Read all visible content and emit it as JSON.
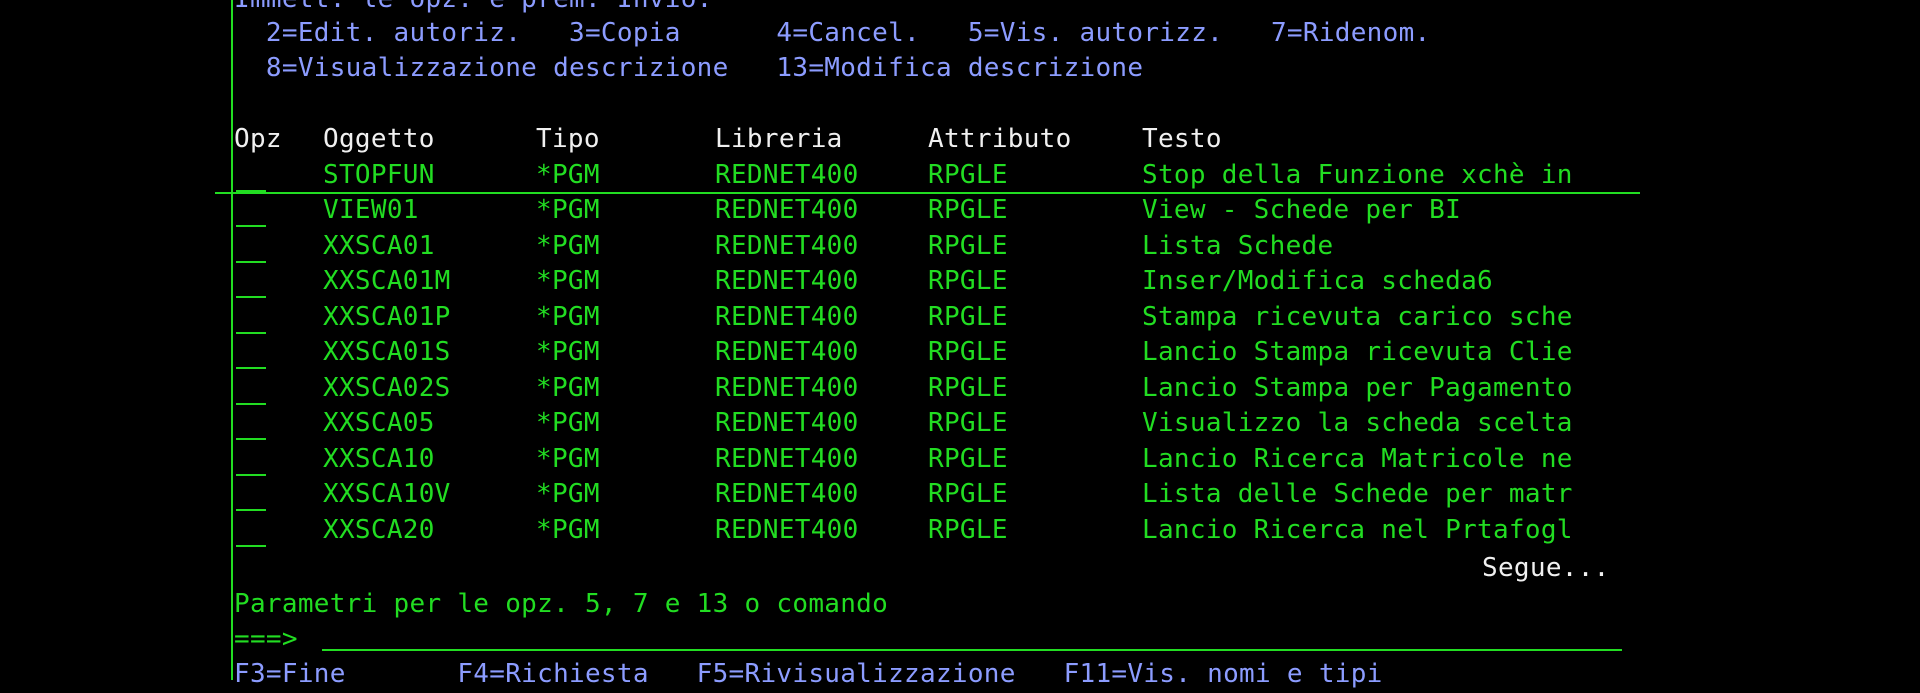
{
  "instructions": {
    "line1": "Immett. le opz. e prem. Invio.",
    "line2": "  2=Edit. autoriz.   3=Copia      4=Cancel.   5=Vis. autorizz.   7=Ridenom.",
    "line3": "  8=Visualizzazione descrizione   13=Modifica descrizione"
  },
  "table": {
    "headers": {
      "opz": "Opz",
      "oggetto": "Oggetto",
      "tipo": "Tipo",
      "libreria": "Libreria",
      "attributo": "Attributo",
      "testo": "Testo"
    },
    "rows": [
      {
        "oggetto": "STOPFUN",
        "tipo": "*PGM",
        "libreria": "REDNET400",
        "attributo": "RPGLE",
        "testo": "Stop della Funzione xchè in"
      },
      {
        "oggetto": "VIEW01",
        "tipo": "*PGM",
        "libreria": "REDNET400",
        "attributo": "RPGLE",
        "testo": "View - Schede per BI"
      },
      {
        "oggetto": "XXSCA01",
        "tipo": "*PGM",
        "libreria": "REDNET400",
        "attributo": "RPGLE",
        "testo": "Lista Schede"
      },
      {
        "oggetto": "XXSCA01M",
        "tipo": "*PGM",
        "libreria": "REDNET400",
        "attributo": "RPGLE",
        "testo": "Inser/Modifica scheda6"
      },
      {
        "oggetto": "XXSCA01P",
        "tipo": "*PGM",
        "libreria": "REDNET400",
        "attributo": "RPGLE",
        "testo": "Stampa ricevuta carico sche"
      },
      {
        "oggetto": "XXSCA01S",
        "tipo": "*PGM",
        "libreria": "REDNET400",
        "attributo": "RPGLE",
        "testo": "Lancio Stampa ricevuta Clie"
      },
      {
        "oggetto": "XXSCA02S",
        "tipo": "*PGM",
        "libreria": "REDNET400",
        "attributo": "RPGLE",
        "testo": "Lancio Stampa per Pagamento"
      },
      {
        "oggetto": "XXSCA05",
        "tipo": "*PGM",
        "libreria": "REDNET400",
        "attributo": "RPGLE",
        "testo": "Visualizzo la scheda scelta"
      },
      {
        "oggetto": "XXSCA10",
        "tipo": "*PGM",
        "libreria": "REDNET400",
        "attributo": "RPGLE",
        "testo": "Lancio Ricerca Matricole ne"
      },
      {
        "oggetto": "XXSCA10V",
        "tipo": "*PGM",
        "libreria": "REDNET400",
        "attributo": "RPGLE",
        "testo": "Lista delle Schede per matr"
      },
      {
        "oggetto": "XXSCA20",
        "tipo": "*PGM",
        "libreria": "REDNET400",
        "attributo": "RPGLE",
        "testo": "Lancio Ricerca nel Prtafogl"
      }
    ],
    "more_indicator": "Segue..."
  },
  "parameters_label": "Parametri per le opz. 5, 7 e 13 o comando",
  "command_prompt": "===>",
  "function_keys": "F3=Fine       F4=Richiesta   F5=Rivisualizzazione   F11=Vis. nomi e tipi",
  "colors": {
    "background": "#000000",
    "green": "#22dd22",
    "blue": "#8c9cff",
    "white": "#f0f0f0"
  }
}
